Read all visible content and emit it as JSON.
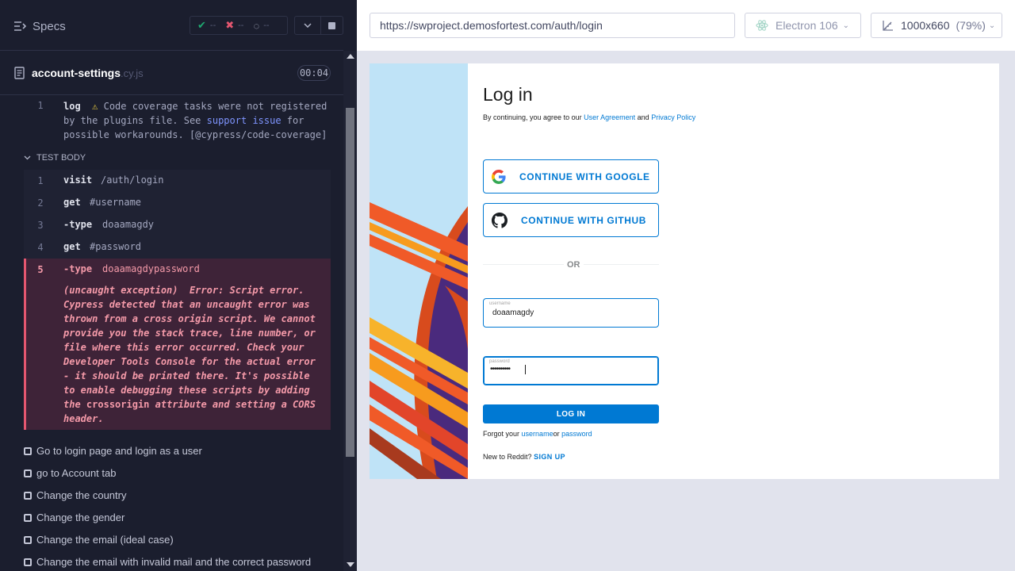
{
  "reporter": {
    "specs_label": "Specs",
    "stats": {
      "passed": "--",
      "failed": "--",
      "pending": "--"
    },
    "spec": {
      "name": "account-settings",
      "ext": ".cy.js",
      "duration": "00:04"
    },
    "log": {
      "line": "1",
      "command": "log",
      "text_before": "Code coverage tasks were not registered by the plugins file. See ",
      "link1": "support",
      "link2": "issue",
      "text_after": " for possible workarounds. [@cypress/code-coverage]"
    },
    "test_body_label": "TEST BODY",
    "commands": [
      {
        "line": "1",
        "name": "visit",
        "arg": "/auth/login"
      },
      {
        "line": "2",
        "name": "get",
        "arg": "#username"
      },
      {
        "line": "3",
        "name": "-type",
        "arg": "doaamagdy"
      },
      {
        "line": "4",
        "name": "get",
        "arg": "#password"
      }
    ],
    "error_command": {
      "line": "5",
      "name": "-type",
      "arg": "doaamagdypassword"
    },
    "error": {
      "prefix": "(uncaught exception)",
      "message": "Error: Script error. Cypress detected that an uncaught error was thrown from a cross origin script. We cannot provide you the stack trace, line number, or file where this error occurred. Check your Developer Tools Console for the actual error - it should be printed there. It's possible to enable debugging these scripts by adding the",
      "code": "crossorigin",
      "suffix": "attribute and setting a CORS header."
    },
    "tests": [
      "Go to login page and login as a user",
      "go to Account tab",
      "Change the country",
      "Change the gender",
      "Change the email (ideal case)",
      "Change the email with invalid mail and the correct password"
    ]
  },
  "browser": {
    "url": "https://swproject.demosfortest.com/auth/login",
    "name": "Electron 106",
    "viewport": "1000x660",
    "zoom": "(79%)"
  },
  "app": {
    "title": "Log in",
    "agree_prefix": "By continuing, you agree to our",
    "user_agreement": "User Agreement",
    "and": "and",
    "privacy_policy": "Privacy Policy",
    "google_button": "CONTINUE WITH GOOGLE",
    "github_button": "CONTINUE WITH GITHUB",
    "or": "OR",
    "username_label": "username",
    "username_value": "doaamagdy",
    "password_label": "password",
    "password_value": "••••••••••",
    "login_button": "LOG IN",
    "forgot_prefix": "Forgot your",
    "forgot_username": "username",
    "forgot_or": "or",
    "forgot_password": "password",
    "new_prefix": "New to Reddit?",
    "signup": "SIGN UP"
  },
  "colors": {
    "reporter_bg": "#1b1e2e",
    "error_bg": "#3e2338",
    "error_text": "#f59aa9",
    "reddit_blue": "#0079d3"
  }
}
